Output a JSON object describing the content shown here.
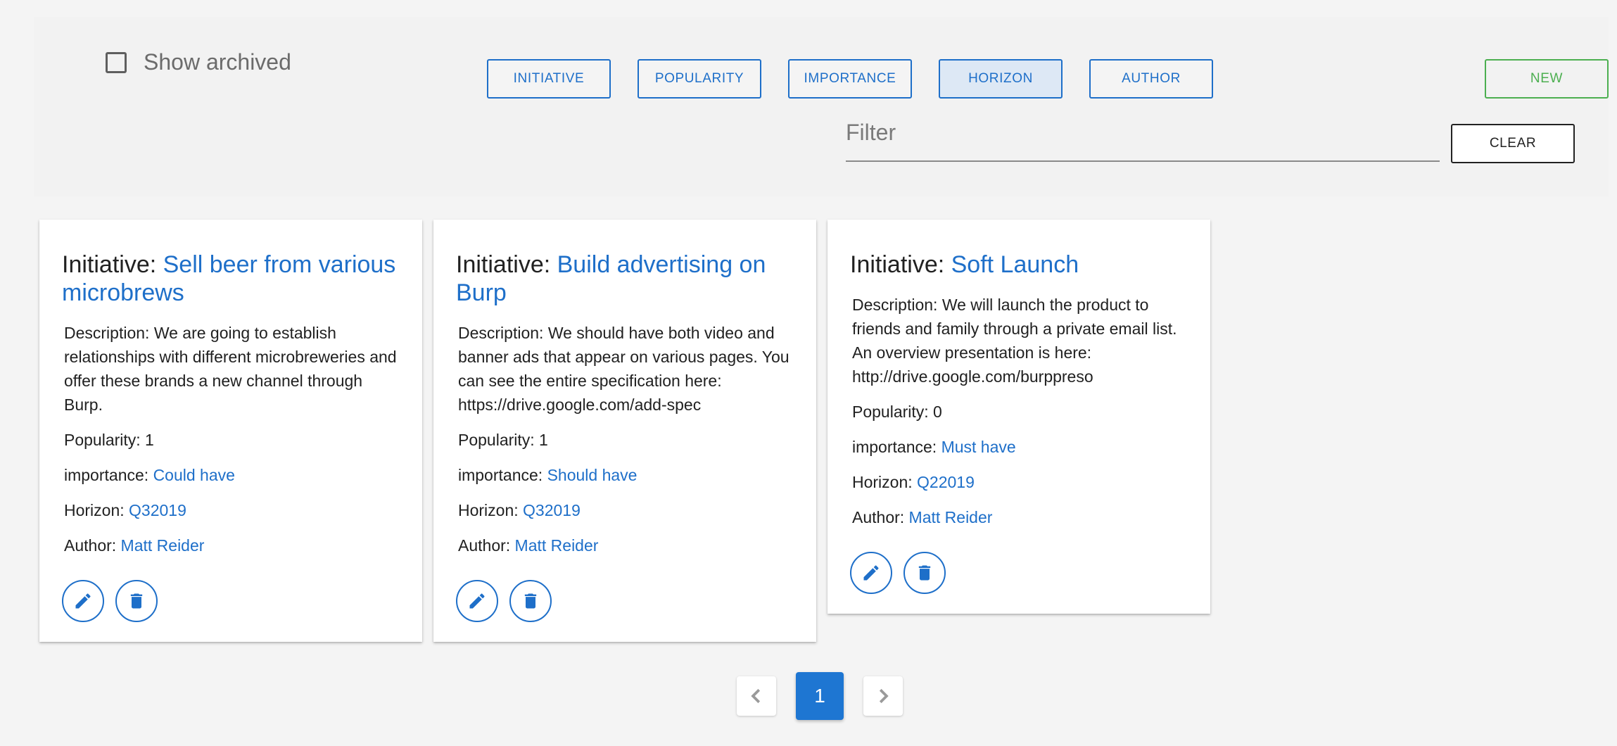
{
  "toolbar": {
    "show_archived_label": "Show archived",
    "sort_buttons": [
      {
        "label": "INITIATIVE",
        "active": false
      },
      {
        "label": "POPULARITY",
        "active": false
      },
      {
        "label": "IMPORTANCE",
        "active": false
      },
      {
        "label": "HORIZON",
        "active": true
      },
      {
        "label": "AUTHOR",
        "active": false
      }
    ],
    "new_label": "NEW",
    "filter_placeholder": "Filter",
    "filter_value": "",
    "clear_label": "CLEAR"
  },
  "cards": [
    {
      "title_prefix": "Initiative: ",
      "name": "Sell beer from various microbrews",
      "description": "Description: We are going to establish relationships with different microbreweries and offer these brands a new channel through Burp.",
      "popularity": "Popularity: 1",
      "importance_label": "importance: ",
      "importance": "Could have",
      "horizon_label": "Horizon: ",
      "horizon": "Q32019",
      "author_label": "Author: ",
      "author": "Matt Reider"
    },
    {
      "title_prefix": "Initiative: ",
      "name": "Build advertising on Burp",
      "description": "Description: We should have both video and banner ads that appear on various pages. You can see the entire specification here: https://drive.google.com/add-spec",
      "popularity": "Popularity: 1",
      "importance_label": "importance: ",
      "importance": "Should have",
      "horizon_label": "Horizon: ",
      "horizon": "Q32019",
      "author_label": "Author: ",
      "author": "Matt Reider"
    },
    {
      "title_prefix": "Initiative: ",
      "name": "Soft Launch",
      "description": "Description: We will launch the product to friends and family through a private email list. An overview presentation is here: http://drive.google.com/burppreso",
      "popularity": "Popularity: 0",
      "importance_label": "importance: ",
      "importance": "Must have",
      "horizon_label": "Horizon: ",
      "horizon": "Q22019",
      "author_label": "Author: ",
      "author": "Matt Reider"
    }
  ],
  "pagination": {
    "current_page": "1"
  },
  "colors": {
    "primary": "#1e6fc9",
    "new_button": "#4caf50",
    "page_active": "#1e76d2"
  },
  "icons": {
    "edit": "pencil-icon",
    "delete": "trash-icon",
    "prev": "chevron-left-icon",
    "next": "chevron-right-icon"
  }
}
